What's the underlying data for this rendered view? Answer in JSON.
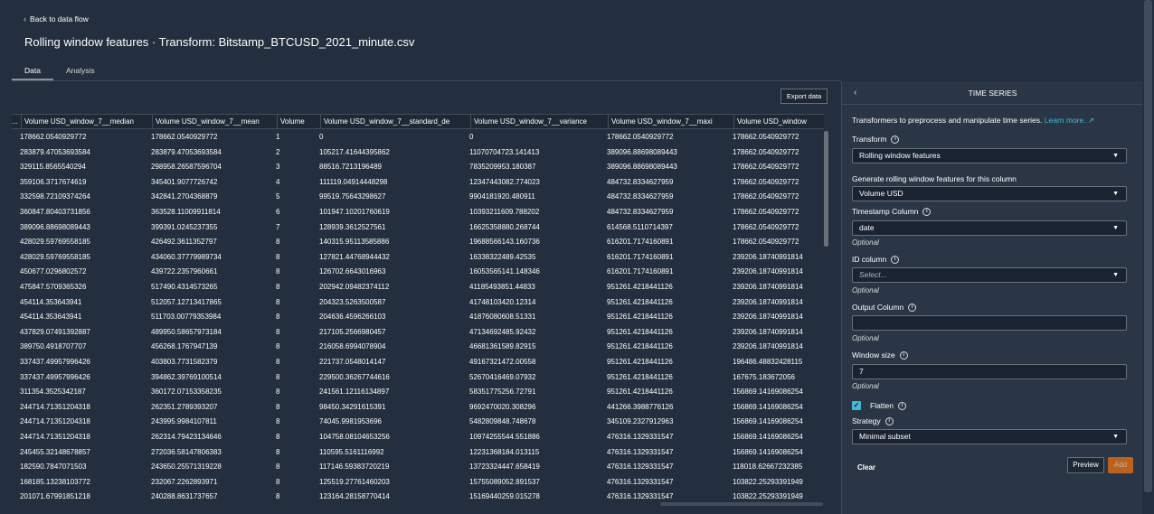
{
  "nav": {
    "back_label": "Back to data flow"
  },
  "page": {
    "title": "Rolling window features · Transform: Bitstamp_BTCUSD_2021_minute.csv"
  },
  "tabs": [
    {
      "label": "Data"
    },
    {
      "label": "Analysis"
    }
  ],
  "toolbar": {
    "export_label": "Export data"
  },
  "table": {
    "columns": [
      "Volume USD_window_7__median",
      "Volume USD_window_7__mean",
      "Volume",
      "Volume USD_window_7__standard_de",
      "Volume USD_window_7__variance",
      "Volume USD_window_7__maxi",
      "Volume USD_window"
    ],
    "rows": [
      [
        "178662.0540929772",
        "178662.0540929772",
        "1",
        "0",
        "0",
        "178662.0540929772",
        "178662.0540929772"
      ],
      [
        "283879.47053693584",
        "283879.47053693584",
        "2",
        "105217.41644395862",
        "11070704723.141413",
        "389096.88698089443",
        "178662.0540929772"
      ],
      [
        "329115.8565540294",
        "298958.26587596704",
        "3",
        "88516.7213196489",
        "7835209953.180387",
        "389096.88698089443",
        "178662.0540929772"
      ],
      [
        "359106.3717674619",
        "345401.9077726742",
        "4",
        "111119.04914448298",
        "12347443082.774023",
        "484732.8334627959",
        "178662.0540929772"
      ],
      [
        "332598.72109374264",
        "342841.2704368879",
        "5",
        "99519.75643298627",
        "9904181920.480911",
        "484732.8334627959",
        "178662.0540929772"
      ],
      [
        "360847.80403731856",
        "363528.11009911814",
        "6",
        "101947.10201760619",
        "10393211609.788202",
        "484732.8334627959",
        "178662.0540929772"
      ],
      [
        "389096.88698089443",
        "399391.0245237355",
        "7",
        "128939.3612527561",
        "16625358880.268744",
        "614568.5110714397",
        "178662.0540929772"
      ],
      [
        "428029.59769558185",
        "426492.3611352797",
        "8",
        "140315.95113585886",
        "19688566143.160736",
        "616201.7174160891",
        "178662.0540929772"
      ],
      [
        "428029.59769558185",
        "434060.37779989734",
        "8",
        "127821.44768944432",
        "16338322489.42535",
        "616201.7174160891",
        "239206.18740991814"
      ],
      [
        "450677.0296802572",
        "439722.2357960661",
        "8",
        "126702.6643016963",
        "16053565141.148346",
        "616201.7174160891",
        "239206.18740991814"
      ],
      [
        "475847.5709365326",
        "517490.4314573265",
        "8",
        "202942.09482374112",
        "41185493851.44833",
        "951261.4218441126",
        "239206.18740991814"
      ],
      [
        "454114.353643941",
        "512057.12713417865",
        "8",
        "204323.5263500587",
        "41748103420.12314",
        "951261.4218441126",
        "239206.18740991814"
      ],
      [
        "454114.353643941",
        "511703.00779353984",
        "8",
        "204636.4596266103",
        "41876080608.51331",
        "951261.4218441126",
        "239206.18740991814"
      ],
      [
        "437829.07491392887",
        "489950.58657973184",
        "8",
        "217105.2566980457",
        "47134692485.92432",
        "951261.4218441126",
        "239206.18740991814"
      ],
      [
        "389750.4918707707",
        "456268.1767947139",
        "8",
        "216058.6994078904",
        "46681361589.82915",
        "951261.4218441126",
        "239206.18740991814"
      ],
      [
        "337437.49957996426",
        "403803.7731582379",
        "8",
        "221737.0548014147",
        "49167321472.00558",
        "951261.4218441126",
        "196486.48832428115"
      ],
      [
        "337437.49957996426",
        "394862.39769100514",
        "8",
        "229500.36267744616",
        "52670416469.07932",
        "951261.4218441126",
        "167675.183672056"
      ],
      [
        "311354.3525342187",
        "360172.07153358235",
        "8",
        "241561.12116134897",
        "58351775256.72791",
        "951261.4218441126",
        "156869.14169086254"
      ],
      [
        "244714.71351204318",
        "262351.2789393207",
        "8",
        "98450.34291615391",
        "9692470020.308296",
        "441266.3988776126",
        "156869.14169086254"
      ],
      [
        "244714.71351204318",
        "243995.9984107811",
        "8",
        "74045.9981953696",
        "5482809848.748678",
        "345109.2327912963",
        "156869.14169086254"
      ],
      [
        "244714.71351204318",
        "262314.79423134646",
        "8",
        "104758.08104653256",
        "10974255544.551886",
        "476316.1329331547",
        "156869.14169086254"
      ],
      [
        "245455.32148678857",
        "272036.58147806383",
        "8",
        "110595.5161116992",
        "12231368184.013115",
        "476316.1329331547",
        "156869.14169086254"
      ],
      [
        "182590.7847071503",
        "243650.25571319228",
        "8",
        "117146.59383720219",
        "13723324447.658419",
        "476316.1329331547",
        "118018.62667232385"
      ],
      [
        "168185.13238103772",
        "232067.2262893971",
        "8",
        "125519.27761460203",
        "15755089052.891537",
        "476316.1329331547",
        "103822.25293391949"
      ],
      [
        "201071.67991851218",
        "240288.8631737657",
        "8",
        "123164.28158770414",
        "15169440259.015278",
        "476316.1329331547",
        "103822.25293391949"
      ]
    ]
  },
  "panel": {
    "title": "TIME SERIES",
    "description": "Transformers to preprocess and manipulate time series.",
    "learn_more": "Learn more.",
    "transform_label": "Transform",
    "transform_value": "Rolling window features",
    "generate_label": "Generate rolling window features for this column",
    "generate_value": "Volume USD",
    "timestamp_label": "Timestamp Column",
    "timestamp_value": "date",
    "optional": "Optional",
    "id_label": "ID column",
    "id_placeholder": "Select...",
    "output_label": "Output Column",
    "output_value": "",
    "window_label": "Window size",
    "window_value": "7",
    "flatten_label": "Flatten",
    "flatten_checked": true,
    "strategy_label": "Strategy",
    "strategy_value": "Minimal subset",
    "clear_label": "Clear",
    "preview_label": "Preview",
    "add_label": "Add"
  }
}
